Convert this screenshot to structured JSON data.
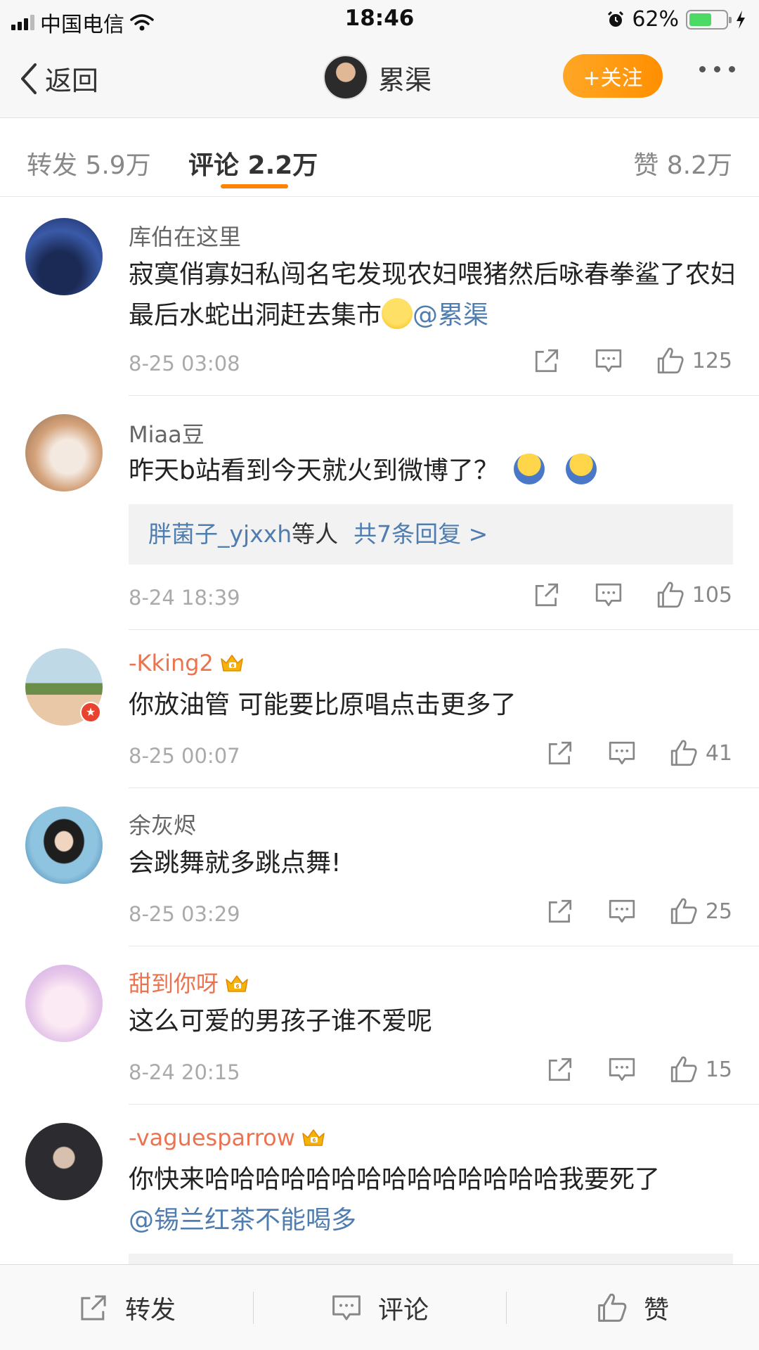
{
  "status_bar": {
    "carrier": "中国电信",
    "time": "18:46",
    "battery": "62%",
    "battery_level": 0.62
  },
  "nav": {
    "back_label": "返回",
    "user_name": "累渠",
    "follow_label": "+关注"
  },
  "tabs": [
    {
      "label": "转发 5.9万"
    },
    {
      "label": "评论 2.2万"
    },
    {
      "label": "赞 8.2万"
    }
  ],
  "comments": [
    {
      "username": "库伯在这里",
      "text": "寂寞俏寡妇私闯名宅发现农妇喂猪然后咏春拳鲨了农妇最后水蛇出洞赶去集市",
      "mention": "@累渠",
      "time": "8-25 03:08",
      "likes": "125"
    },
    {
      "username": "Miaa豆",
      "text": "昨天b站看到今天就火到微博了？",
      "reply_names": "胖菌子_yjxxh",
      "reply_suffix": "等人",
      "reply_more": "共7条回复 >",
      "time": "8-24 18:39",
      "likes": "105"
    },
    {
      "username": "-Kking2",
      "text": "你放油管 可能要比原唱点击更多了",
      "time": "8-25 00:07",
      "likes": "41"
    },
    {
      "username": "余灰烬",
      "text": "会跳舞就多跳点舞!",
      "time": "8-25 03:29",
      "likes": "25"
    },
    {
      "username": "甜到你呀",
      "text": "这么可爱的男孩子谁不爱呢",
      "time": "8-24 20:15",
      "likes": "15"
    },
    {
      "username": "-vaguesparrow",
      "text": "你快来哈哈哈哈哈哈哈哈哈哈哈哈哈哈我要死了",
      "mention": "@锡兰红茶不能喝多"
    }
  ],
  "bottom_bar": {
    "repost": "转发",
    "comment": "评论",
    "like": "赞"
  },
  "colors": {
    "accent": "#ff8200",
    "link": "#507daf",
    "vip_name": "#eb7350"
  }
}
